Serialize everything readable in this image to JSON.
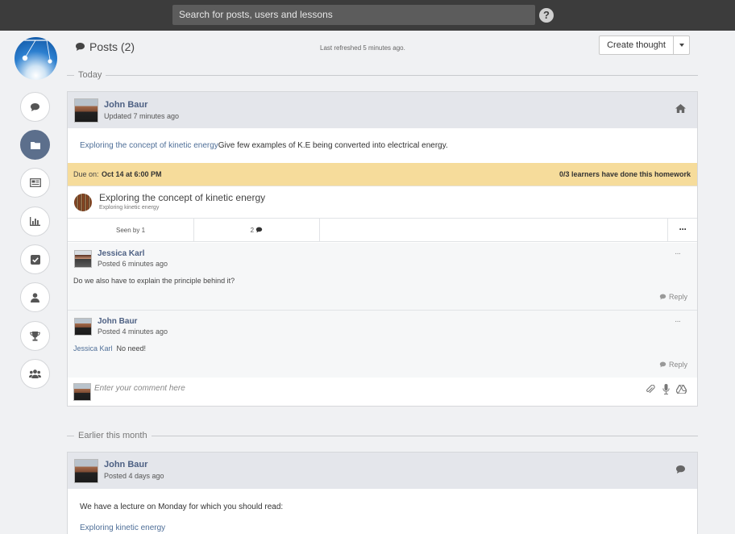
{
  "topbar": {
    "search_placeholder": "Search for posts, users and lessons",
    "help_label": "?"
  },
  "sidebar": {
    "items": [
      {
        "name": "posts",
        "icon": "chat-bubble-icon",
        "active": false
      },
      {
        "name": "folders",
        "icon": "folder-icon",
        "active": true
      },
      {
        "name": "news",
        "icon": "newspaper-icon",
        "active": false
      },
      {
        "name": "reports",
        "icon": "bar-chart-icon",
        "active": false
      },
      {
        "name": "tasks",
        "icon": "checkbox-icon",
        "active": false
      },
      {
        "name": "profile",
        "icon": "user-icon",
        "active": false
      },
      {
        "name": "awards",
        "icon": "trophy-icon",
        "active": false
      },
      {
        "name": "groups",
        "icon": "users-icon",
        "active": false
      }
    ]
  },
  "header": {
    "title": "Posts (2)",
    "last_refreshed": "Last refreshed 5 minutes ago.",
    "create_label": "Create thought"
  },
  "sections": {
    "today": "Today",
    "earlier": "Earlier this month"
  },
  "post1": {
    "author": "John Baur",
    "updated": "Updated 7 minutes ago",
    "type_icon": "home-icon",
    "body_link": "Exploring the concept of kinetic energy",
    "body_text": "Give few examples of K.E being converted into electrical energy.",
    "due_label": "Due on:",
    "due_value": "Oct 14 at 6:00 PM",
    "homework_status": "0/3 learners have done this homework",
    "lesson_title": "Exploring the concept of kinetic energy",
    "lesson_subtitle": "Exploring kinetic energy",
    "seen_by": "Seen by 1",
    "comment_count": "2",
    "more_label": "···",
    "comments": [
      {
        "author": "Jessica Karl",
        "time": "Posted 6 minutes ago",
        "text": "Do we also have to explain the principle behind it?",
        "mention": "",
        "reply_label": "Reply"
      },
      {
        "author": "John Baur",
        "time": "Posted 4 minutes ago",
        "mention": "Jessica Karl",
        "text": "No need!",
        "reply_label": "Reply"
      }
    ],
    "comment_placeholder": "Enter your comment here"
  },
  "post2": {
    "author": "John Baur",
    "time": "Posted 4 days ago",
    "type_icon": "chat-bubble-icon",
    "body_text": "We have a lecture on Monday for which you should read:",
    "body_link": "Exploring kinetic energy"
  },
  "colors": {
    "topbar": "#3c3c3c",
    "accent_link": "#4f6f98",
    "due_bar": "#f6dc9b",
    "active_nav": "#5c6f8c"
  }
}
